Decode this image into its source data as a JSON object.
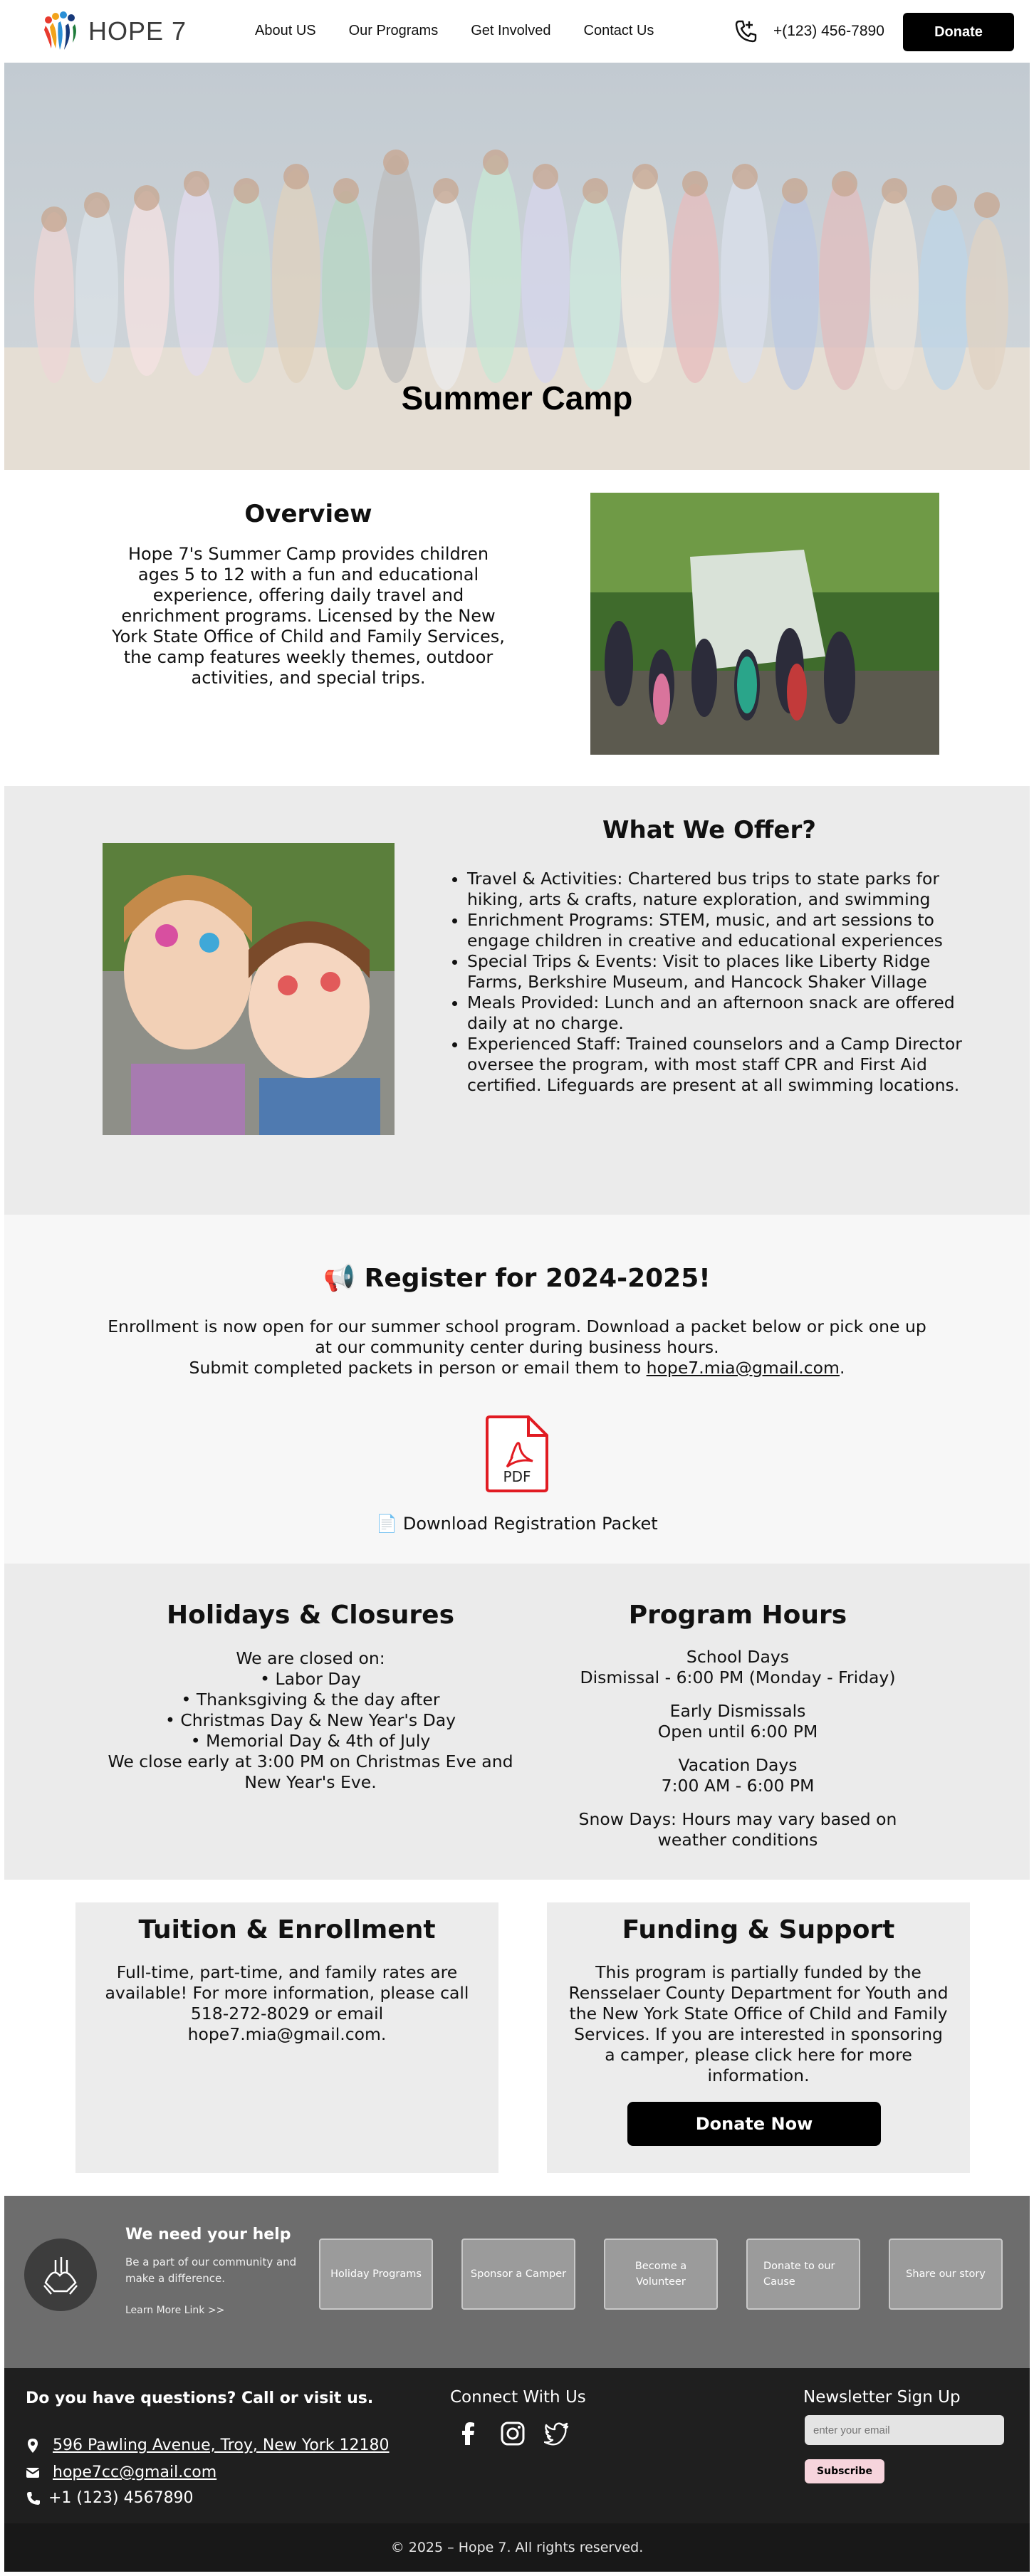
{
  "header": {
    "logo_text": "HOPE 7",
    "nav": [
      "About US",
      "Our Programs",
      "Get Involved",
      "Contact Us"
    ],
    "phone": "+(123) 456-7890",
    "donate_label": "Donate"
  },
  "hero": {
    "title": "Summer Camp"
  },
  "overview": {
    "title": "Overview",
    "text": "Hope 7's Summer Camp provides children ages 5 to 12 with a fun and educational experience, offering daily travel and enrichment programs. Licensed by the New York State Office of Child and Family Services, the camp features weekly themes, outdoor activities, and special trips."
  },
  "offer": {
    "title": "What We Offer?",
    "items": [
      "Travel & Activities: Chartered bus trips to state parks for hiking, arts & crafts, nature exploration, and swimming",
      "Enrichment Programs: STEM, music, and art sessions to engage children in creative and educational experiences",
      "Special Trips & Events: Visit to places like Liberty Ridge Farms, Berkshire Museum, and Hancock Shaker Village",
      "Meals Provided: Lunch and an afternoon snack are offered daily at no charge.",
      "Experienced Staff: Trained counselors and a Camp Director oversee the program, with most staff CPR and First Aid certified. Lifeguards are present at all swimming locations."
    ]
  },
  "register": {
    "icon": "📢",
    "title": "Register for 2024-2025!",
    "line1": "Enrollment is now open for our summer school program. Download a packet below or pick one up at our community center during business hours.",
    "line2_prefix": "Submit completed packets in person or email them to ",
    "email": "hope7.mia@gmail.com",
    "line2_suffix": ".",
    "pdf_label": "PDF",
    "download_icon": "📄",
    "download_label": "Download Registration Packet"
  },
  "holidays": {
    "title": "Holidays & Closures",
    "intro": "We are closed on:",
    "items": [
      "Labor Day",
      "Thanksgiving & the day after",
      "Christmas Day & New Year's Day",
      "Memorial Day & 4th of July"
    ],
    "note": "We close early at 3:00 PM on Christmas Eve and New Year's Eve."
  },
  "hours": {
    "title": "Program Hours",
    "school_label": "School Days",
    "school_value": "Dismissal - 6:00 PM (Monday - Friday)",
    "early_label": "Early Dismissals",
    "early_value": "Open until 6:00 PM",
    "vacation_label": "Vacation Days",
    "vacation_value": "7:00 AM - 6:00 PM",
    "snow": "Snow Days: Hours may vary based on weather conditions"
  },
  "tuition": {
    "title": "Tuition & Enrollment",
    "text": "Full-time, part-time, and family rates are available! For more information, please call 518-272-8029 or email hope7.mia@gmail.com."
  },
  "funding": {
    "title": "Funding & Support",
    "text": "This program is partially funded by the Rensselaer County Department for Youth and the New York State Office of Child and Family Services. If you are interested in sponsoring a camper, please click here for more information.",
    "button": "Donate Now"
  },
  "help": {
    "title": "We need your help",
    "subtitle": "Be a part of our community and make a difference.",
    "link": "Learn More Link >>",
    "buttons": [
      "Holiday Programs",
      "Sponsor a Camper",
      "Become a Volunteer",
      "Donate to our Cause",
      "Share our story"
    ]
  },
  "footer": {
    "question": "Do you have questions? Call or visit us.",
    "address": "596 Pawling Avenue, Troy, New York 12180",
    "email": "hope7cc@gmail.com",
    "phone": "+1 (123) 4567890",
    "connect": "Connect With Us",
    "newsletter": "Newsletter Sign Up",
    "email_placeholder": "enter your email",
    "subscribe": "Subscribe",
    "copyright": "© 2025 – Hope 7. All rights reserved."
  }
}
